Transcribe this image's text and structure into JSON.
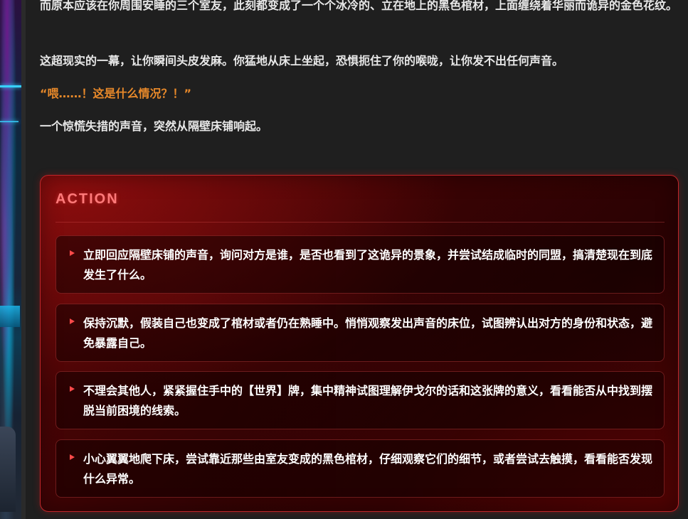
{
  "story": {
    "paragraphs": [
      "而原本应该在你周围安睡的三个室友，此刻都变成了一个个冰冷的、立在地上的黑色棺材，上面缠绕着华丽而诡异的金色花纹。",
      "这超现实的一幕，让你瞬间头皮发麻。你猛地从床上坐起，恐惧扼住了你的喉咙，让你发不出任何声音。",
      "“喂……！这是什么情况？！”",
      "一个惊慌失措的声音，突然从隔壁床铺响起。"
    ]
  },
  "action": {
    "title": "ACTION",
    "options": [
      "立即回应隔壁床铺的声音，询问对方是谁，是否也看到了这诡异的景象，并尝试结成临时的同盟，搞清楚现在到底发生了什么。",
      "保持沉默，假装自己也变成了棺材或者仍在熟睡中。悄悄观察发出声音的床位，试图辨认出对方的身份和状态，避免暴露自己。",
      "不理会其他人，紧紧握住手中的【世界】牌，集中精神试图理解伊戈尔的话和这张牌的意义，看看能否从中找到摆脱当前困境的线索。",
      "小心翼翼地爬下床，尝试靠近那些由室友变成的黑色棺材，仔细观察它们的细节，或者尝试去触摸，看看能否发现什么异常。"
    ]
  },
  "colors": {
    "background": "#1f1f1f",
    "story_text": "#e8e8e8",
    "dialogue_text": "#e8892a",
    "action_border": "#c0262a",
    "action_title": "#ff7a7a",
    "option_arrow": "#ff4a4a"
  }
}
